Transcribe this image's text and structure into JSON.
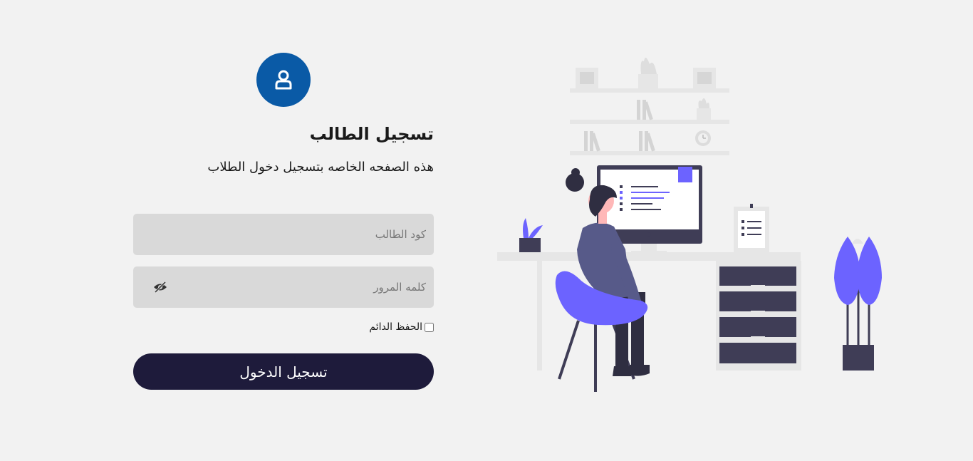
{
  "login": {
    "title": "تسجيل الطالب",
    "subtitle": "هذه الصفحه الخاصه بتسجيل دخول الطلاب",
    "student_code_placeholder": "كود الطالب",
    "password_placeholder": "كلمه المرور",
    "remember_label": "الحفظ الدائم",
    "submit_label": "تسجيل الدخول"
  },
  "icons": {
    "avatar": "user-icon",
    "password_toggle": "eye-slash-icon"
  },
  "colors": {
    "page_background": "#f2f2f2",
    "avatar_background": "#0a5aa6",
    "input_background": "#d9d9d9",
    "button_background": "#1e1b3b",
    "illustration_accent": "#6c63ff",
    "illustration_dark": "#3f3d56"
  }
}
